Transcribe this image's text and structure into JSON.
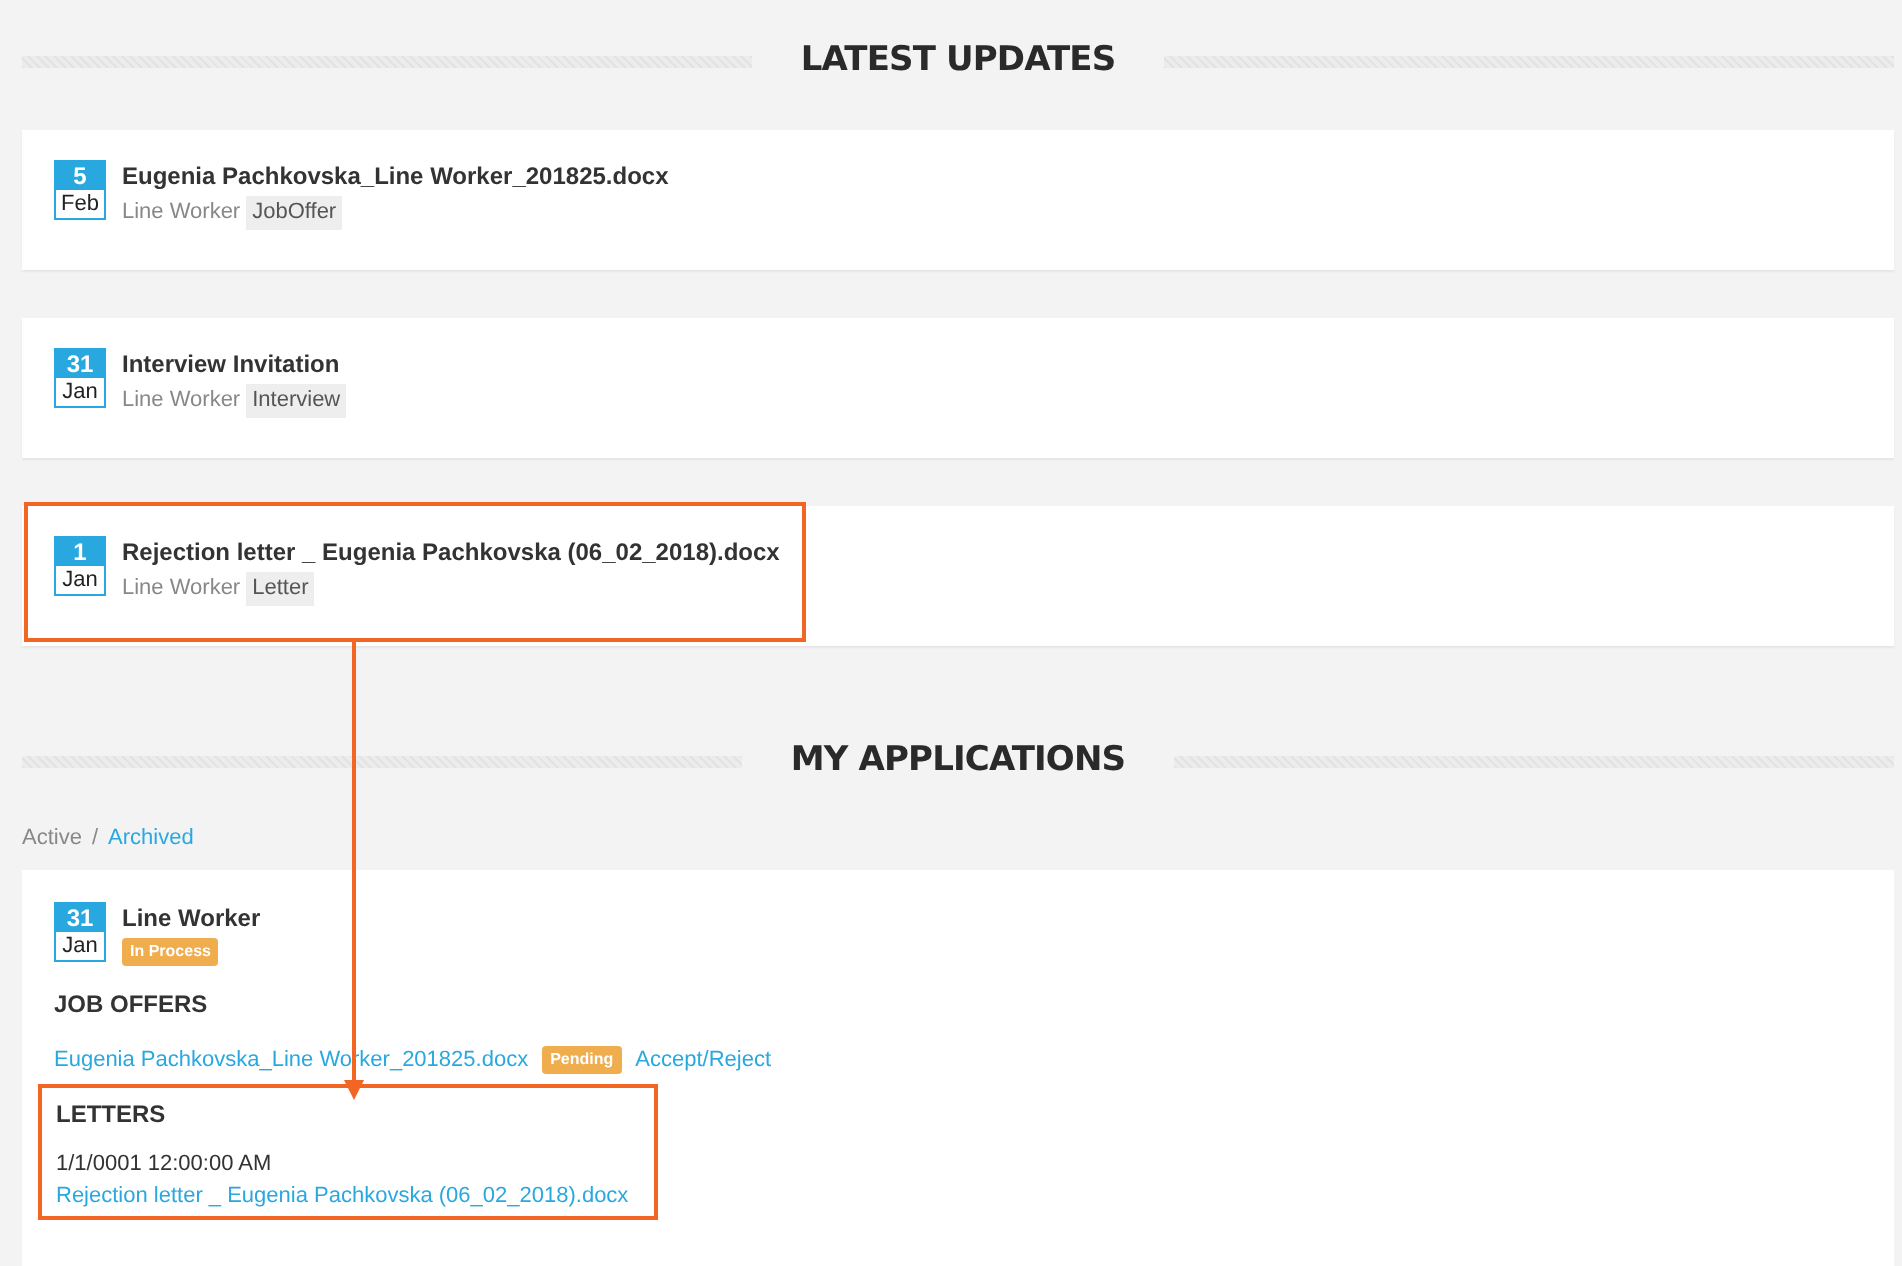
{
  "latest_updates": {
    "title": "LATEST UPDATES",
    "items": [
      {
        "day": "5",
        "month": "Feb",
        "title": "Eugenia Pachkovska_Line Worker_201825.docx",
        "position": "Line Worker",
        "tag": "JobOffer",
        "highlighted": false
      },
      {
        "day": "31",
        "month": "Jan",
        "title": "Interview Invitation",
        "position": "Line Worker",
        "tag": "Interview",
        "highlighted": false
      },
      {
        "day": "1",
        "month": "Jan",
        "title": "Rejection letter _ Eugenia Pachkovska (06_02_2018).docx",
        "position": "Line Worker",
        "tag": "Letter",
        "highlighted": true
      }
    ]
  },
  "my_applications": {
    "title": "MY APPLICATIONS",
    "filters": [
      {
        "label": "Active",
        "selected": true
      },
      {
        "label": "Archived",
        "selected": false
      }
    ],
    "separator": "/",
    "application": {
      "day": "31",
      "month": "Jan",
      "title": "Line Worker",
      "status": "In Process",
      "job_offers_heading": "JOB OFFERS",
      "job_offers": [
        {
          "file": "Eugenia Pachkovska_Line Worker_201825.docx",
          "status": "Pending",
          "action": "Accept/Reject"
        }
      ],
      "letters_heading": "LETTERS",
      "letters_highlighted": true,
      "letters": [
        {
          "date": "1/1/0001 12:00:00 AM",
          "file": "Rejection letter _ Eugenia Pachkovska (06_02_2018).docx"
        }
      ]
    }
  }
}
